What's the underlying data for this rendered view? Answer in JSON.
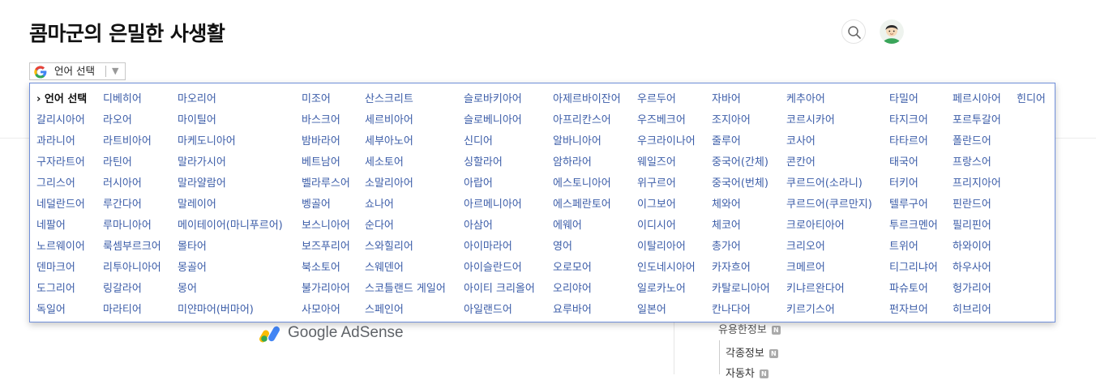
{
  "site": {
    "title": "콤마군의 은밀한 사생활"
  },
  "language_selector": {
    "label": "언어 선택",
    "arrow": "▼"
  },
  "language_menu": {
    "columns": [
      [
        "› 언어 선택",
        "갈리시아어",
        "과라니어",
        "구자라트어",
        "그리스어",
        "네덜란드어",
        "네팔어",
        "노르웨이어",
        "덴마크어",
        "도그리어",
        "독일어"
      ],
      [
        "디베히어",
        "라오어",
        "라트비아어",
        "라틴어",
        "러시아어",
        "루간다어",
        "루마니아어",
        "룩셈부르크어",
        "리투아니아어",
        "링갈라어",
        "마라티어"
      ],
      [
        "마오리어",
        "마이틸어",
        "마케도니아어",
        "말라가시어",
        "말라얄람어",
        "말레이어",
        "메이테이어(마니푸르어)",
        "몰타어",
        "몽골어",
        "몽어",
        "미얀마어(버마어)"
      ],
      [
        "미조어",
        "바스크어",
        "밤바라어",
        "베트남어",
        "벨라루스어",
        "벵골어",
        "보스니아어",
        "보즈푸리어",
        "북소토어",
        "불가리아어",
        "사모아어"
      ],
      [
        "산스크리트",
        "세르비아어",
        "세부아노어",
        "세소토어",
        "소말리아어",
        "쇼나어",
        "순다어",
        "스와힐리어",
        "스웨덴어",
        "스코틀랜드 게일어",
        "스페인어"
      ],
      [
        "슬로바키아어",
        "슬로베니아어",
        "신디어",
        "싱할라어",
        "아랍어",
        "아르메니아어",
        "아삼어",
        "아이마라어",
        "아이슬란드어",
        "아이티 크리올어",
        "아일랜드어"
      ],
      [
        "아제르바이잔어",
        "아프리칸스어",
        "알바니아어",
        "암하라어",
        "에스토니아어",
        "에스페란토어",
        "에웨어",
        "영어",
        "오로모어",
        "오리야어",
        "요루바어"
      ],
      [
        "우르두어",
        "우즈베크어",
        "우크라이나어",
        "웨일즈어",
        "위구르어",
        "이그보어",
        "이디시어",
        "이탈리아어",
        "인도네시아어",
        "일로카노어",
        "일본어"
      ],
      [
        "자바어",
        "조지아어",
        "줄루어",
        "중국어(간체)",
        "중국어(번체)",
        "체와어",
        "체코어",
        "총가어",
        "카자흐어",
        "카탈로니아어",
        "칸나다어"
      ],
      [
        "케추아어",
        "코르시카어",
        "코사어",
        "콘칸어",
        "쿠르드어(소라니)",
        "쿠르드어(쿠르만지)",
        "크로아티아어",
        "크리오어",
        "크메르어",
        "키냐르완다어",
        "키르기스어"
      ],
      [
        "타밀어",
        "타지크어",
        "타타르어",
        "태국어",
        "터키어",
        "텔루구어",
        "투르크멘어",
        "트위어",
        "티그리냐어",
        "파슈토어",
        "펀자브어"
      ],
      [
        "페르시아어",
        "포르투갈어",
        "폴란드어",
        "프랑스어",
        "프리지아어",
        "핀란드어",
        "필리핀어",
        "하와이어",
        "하우사어",
        "헝가리어",
        "히브리어"
      ],
      [
        "힌디어"
      ]
    ]
  },
  "ad": {
    "text": "Google AdSense"
  },
  "sidebar": {
    "categories": [
      {
        "label": "유용한정보",
        "badge": "N"
      },
      {
        "label": "각종정보",
        "badge": "N"
      },
      {
        "label": "자동차",
        "badge": "N"
      }
    ]
  },
  "colors": {
    "menu_border": "#6f8ed9",
    "menu_link": "#3b5ca8"
  }
}
